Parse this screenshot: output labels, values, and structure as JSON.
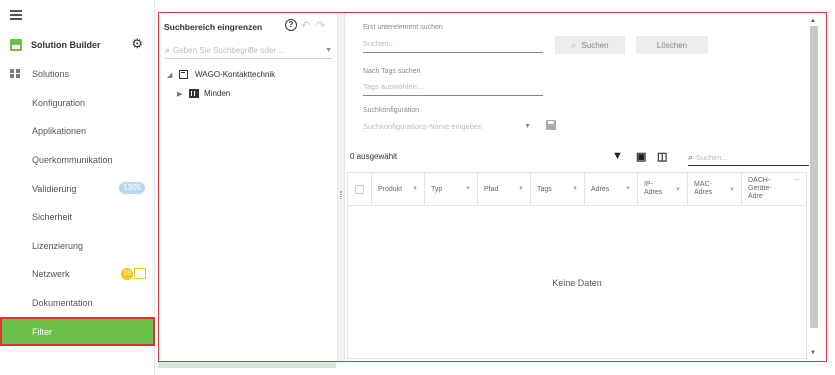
{
  "sidebar": {
    "brand": "Solution Builder",
    "items": [
      {
        "label": "Solutions"
      },
      {
        "label": "Konfiguration"
      },
      {
        "label": "Applikationen"
      },
      {
        "label": "Querkommunikation"
      },
      {
        "label": "Validierung",
        "badge": "1305"
      },
      {
        "label": "Sicherheit"
      },
      {
        "label": "Lizenzierung"
      },
      {
        "label": "Netzwerk",
        "badge": "18"
      },
      {
        "label": "Dokumentation"
      },
      {
        "label": "Filter",
        "active": true
      }
    ]
  },
  "tree": {
    "title": "Suchbereich eingrenzen",
    "search_placeholder": "Geben Sie Suchbegriffe oder ...",
    "nodes": [
      {
        "label": "WAGO-Kontakttechnik"
      },
      {
        "label": "Minden"
      }
    ]
  },
  "content": {
    "property_label": "Erst unterelement suchen",
    "search_placeholder": "Suchen...",
    "search_button": "Suchen",
    "clear_button": "Löschen",
    "tags_label": "Nach Tags suchen",
    "tags_placeholder": "Tags auswählen...",
    "config_label": "Suchkonfiguration",
    "config_placeholder": "Suchkonfigurations-Name eingeben",
    "selected_count": "0 ausgewählt",
    "table_search_placeholder": "Suchen...",
    "columns": [
      {
        "label": "Produkt"
      },
      {
        "label": "Typ"
      },
      {
        "label": "Pfad"
      },
      {
        "label": "Tags"
      },
      {
        "label": "Adres"
      },
      {
        "label": "IP-Adres"
      },
      {
        "label": "MAC-Adres"
      },
      {
        "label": "DACH-Geräte-Adre"
      }
    ],
    "empty_message": "Keine Daten"
  },
  "colors": {
    "accent_green": "#6cc04a",
    "highlight_red": "#d9343a",
    "badge_blue": "#b9d7ef",
    "badge_yellow": "#f0c419"
  }
}
